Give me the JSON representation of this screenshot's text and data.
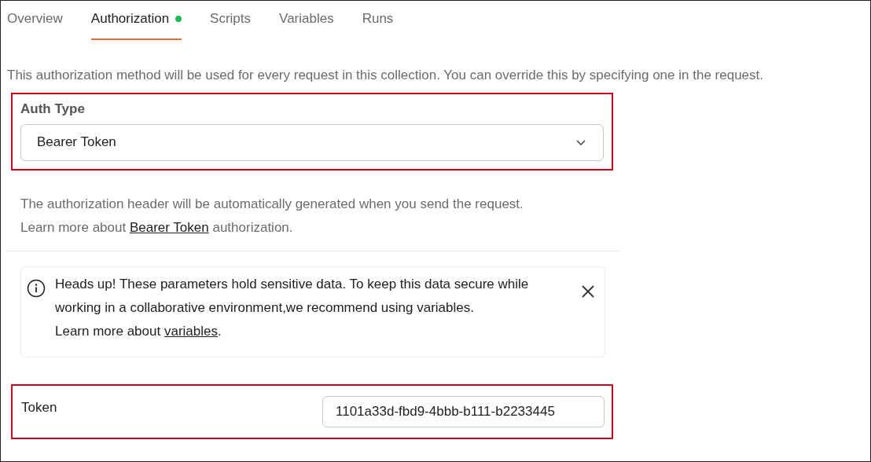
{
  "tabs": [
    {
      "label": "Overview",
      "selected": false,
      "dot": false
    },
    {
      "label": "Authorization",
      "selected": true,
      "dot": true
    },
    {
      "label": "Scripts",
      "selected": false,
      "dot": false
    },
    {
      "label": "Variables",
      "selected": false,
      "dot": false
    },
    {
      "label": "Runs",
      "selected": false,
      "dot": false
    }
  ],
  "description": "This authorization method will be used for every request in this collection. You can override this by specifying one in the request.",
  "auth_type": {
    "label": "Auth Type",
    "value": "Bearer Token",
    "highlighted": true
  },
  "help": {
    "line1": "The authorization header will be automatically generated when you send the request.",
    "before": "Learn more about ",
    "link": "Bearer Token",
    "after": " authorization."
  },
  "alert": {
    "line1": "Heads up! These parameters hold sensitive data. To keep this data secure while working in a collaborative environment,we recommend using variables.",
    "before": "Learn more about ",
    "link": "variables",
    "after": "."
  },
  "token": {
    "label": "Token",
    "value": "1101a33d-fbd9-4bbb-b111-b2233445",
    "highlighted": true
  }
}
